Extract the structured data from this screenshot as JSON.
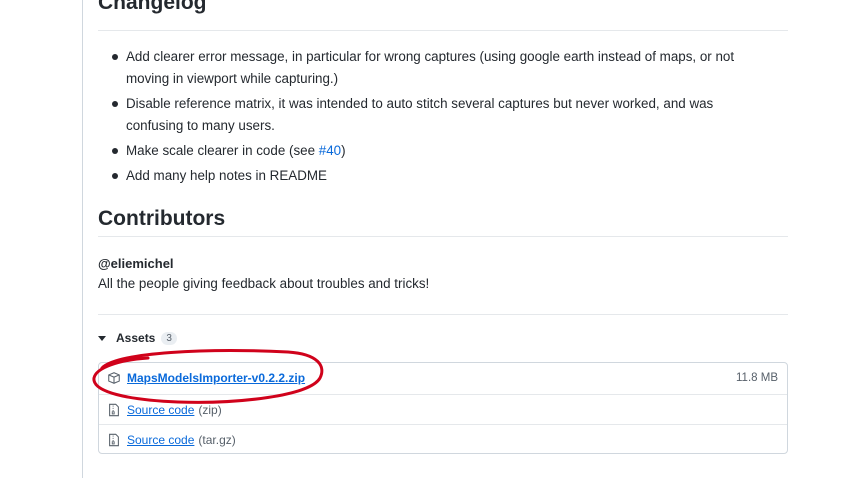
{
  "changelog": {
    "title": "Changelog",
    "items": [
      {
        "text": "Add clearer error message, in particular for wrong captures (using google earth instead of maps, or not moving in viewport while capturing.)"
      },
      {
        "text": "Disable reference matrix, it was intended to auto stitch several captures but never worked, and was confusing to many users."
      },
      {
        "text_before": "Make scale clearer in code (see ",
        "link": "#40",
        "text_after": ")"
      },
      {
        "text": "Add many help notes in README"
      }
    ]
  },
  "contributors": {
    "title": "Contributors",
    "handle": "@eliemichel",
    "thanks": "All the people giving feedback about troubles and tricks!"
  },
  "assets": {
    "label": "Assets",
    "count": "3",
    "files": [
      {
        "name": "MapsModelsImporter-v0.2.2.zip",
        "size": "11.8 MB",
        "icon": "package-icon"
      },
      {
        "name": "Source code",
        "ext": "(zip)",
        "icon": "file-zip-icon"
      },
      {
        "name": "Source code",
        "ext": "(tar.gz)",
        "icon": "file-zip-icon"
      }
    ]
  },
  "colors": {
    "link": "#0969da",
    "text": "#24292f",
    "muted": "#57606a",
    "border": "#d0d7de",
    "annotation": "#d0021b"
  }
}
